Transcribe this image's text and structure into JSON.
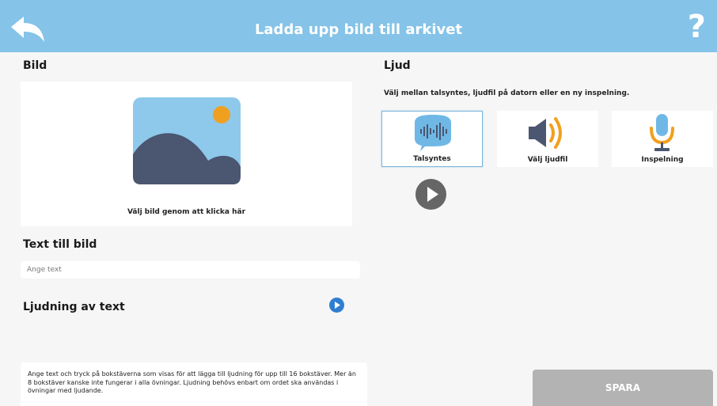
{
  "header": {
    "title": "Ladda upp bild till arkivet",
    "help_label": "?"
  },
  "image_section": {
    "label": "Bild",
    "hint": "Välj bild genom att klicka här"
  },
  "text_section": {
    "label": "Text till bild",
    "placeholder": "Ange text",
    "value": ""
  },
  "sound_text_section": {
    "label": "Ljudning av text",
    "info": "Ange text och tryck på bokstäverna som visas för att lägga till ljudning för upp till 16 bokstäver. Mer än 8 bokstäver kanske inte fungerar i alla övningar. Ljudning behövs enbart om ordet ska användas i övningar med ljudande."
  },
  "audio_section": {
    "label": "Ljud",
    "description": "Välj mellan talsyntes, ljudfil på datorn eller en ny inspelning.",
    "options": [
      {
        "label": "Talsyntes",
        "icon": "speech-bubble-waveform-icon",
        "selected": true
      },
      {
        "label": "Välj ljudfil",
        "icon": "speaker-icon",
        "selected": false
      },
      {
        "label": "Inspelning",
        "icon": "microphone-icon",
        "selected": false
      }
    ]
  },
  "save_label": "SPARA",
  "colors": {
    "header": "#85c3e8",
    "accent_blue": "#2f7fd1",
    "icon_blue": "#6fb8e6",
    "icon_dark": "#4b5670",
    "icon_orange": "#f0a020",
    "save_disabled": "#b3b3b3",
    "play_gray": "#666666"
  }
}
